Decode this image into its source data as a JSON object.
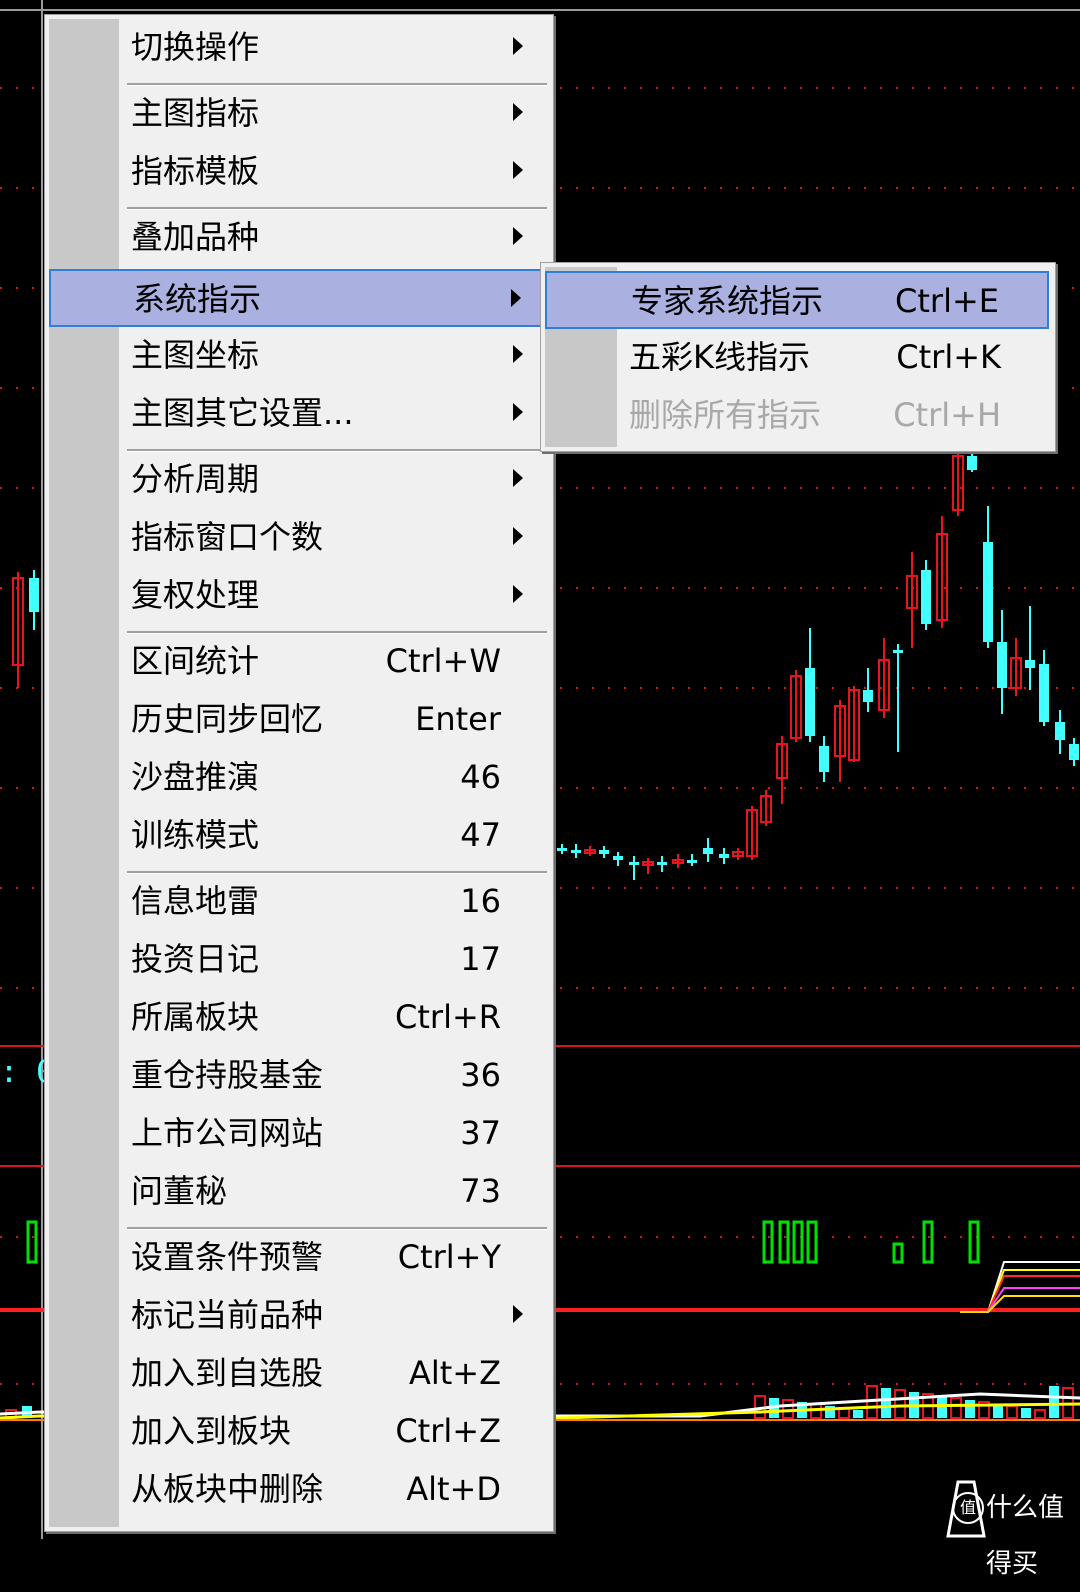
{
  "colors": {
    "up": "#e8141e",
    "down": "#44ffff",
    "grid": "#d4161c",
    "volume_signal": "#00e000",
    "highlight": "#aab0e0",
    "highlight_border": "#2f7fd6"
  },
  "chart_overlay": {
    "axis_readout": ": 0"
  },
  "main_menu": {
    "items": [
      {
        "label": "切换操作",
        "shortcut": "",
        "submenu": true
      },
      {
        "label": "主图指标",
        "shortcut": "",
        "submenu": true
      },
      {
        "label": "指标模板",
        "shortcut": "",
        "submenu": true
      },
      {
        "label": "叠加品种",
        "shortcut": "",
        "submenu": true
      },
      {
        "label": "系统指示",
        "shortcut": "",
        "submenu": true,
        "highlighted": true
      },
      {
        "label": "主图坐标",
        "shortcut": "",
        "submenu": true
      },
      {
        "label": "主图其它设置...",
        "shortcut": "",
        "submenu": true
      },
      {
        "label": "分析周期",
        "shortcut": "",
        "submenu": true
      },
      {
        "label": "指标窗口个数",
        "shortcut": "",
        "submenu": true
      },
      {
        "label": "复权处理",
        "shortcut": "",
        "submenu": true
      },
      {
        "label": "区间统计",
        "shortcut": "Ctrl+W",
        "submenu": false
      },
      {
        "label": "历史同步回忆",
        "shortcut": "Enter",
        "submenu": false
      },
      {
        "label": "沙盘推演",
        "shortcut": "46",
        "submenu": false
      },
      {
        "label": "训练模式",
        "shortcut": "47",
        "submenu": false
      },
      {
        "label": "信息地雷",
        "shortcut": "16",
        "submenu": false
      },
      {
        "label": "投资日记",
        "shortcut": "17",
        "submenu": false
      },
      {
        "label": "所属板块",
        "shortcut": "Ctrl+R",
        "submenu": false
      },
      {
        "label": "重仓持股基金",
        "shortcut": "36",
        "submenu": false
      },
      {
        "label": "上市公司网站",
        "shortcut": "37",
        "submenu": false
      },
      {
        "label": "问董秘",
        "shortcut": "73",
        "submenu": false
      },
      {
        "label": "设置条件预警",
        "shortcut": "Ctrl+Y",
        "submenu": false
      },
      {
        "label": "标记当前品种",
        "shortcut": "",
        "submenu": true
      },
      {
        "label": "加入到自选股",
        "shortcut": "Alt+Z",
        "submenu": false
      },
      {
        "label": "加入到板块",
        "shortcut": "Ctrl+Z",
        "submenu": false
      },
      {
        "label": "从板块中删除",
        "shortcut": "Alt+D",
        "submenu": false
      }
    ]
  },
  "sub_menu": {
    "items": [
      {
        "label": "专家系统指示",
        "shortcut": "Ctrl+E",
        "highlighted": true,
        "disabled": false
      },
      {
        "label": "五彩K线指示",
        "shortcut": "Ctrl+K",
        "highlighted": false,
        "disabled": false
      },
      {
        "label": "删除所有指示",
        "shortcut": "Ctrl+H",
        "highlighted": false,
        "disabled": true
      }
    ]
  },
  "watermark": {
    "icon": "值",
    "text": "什么值得买"
  }
}
